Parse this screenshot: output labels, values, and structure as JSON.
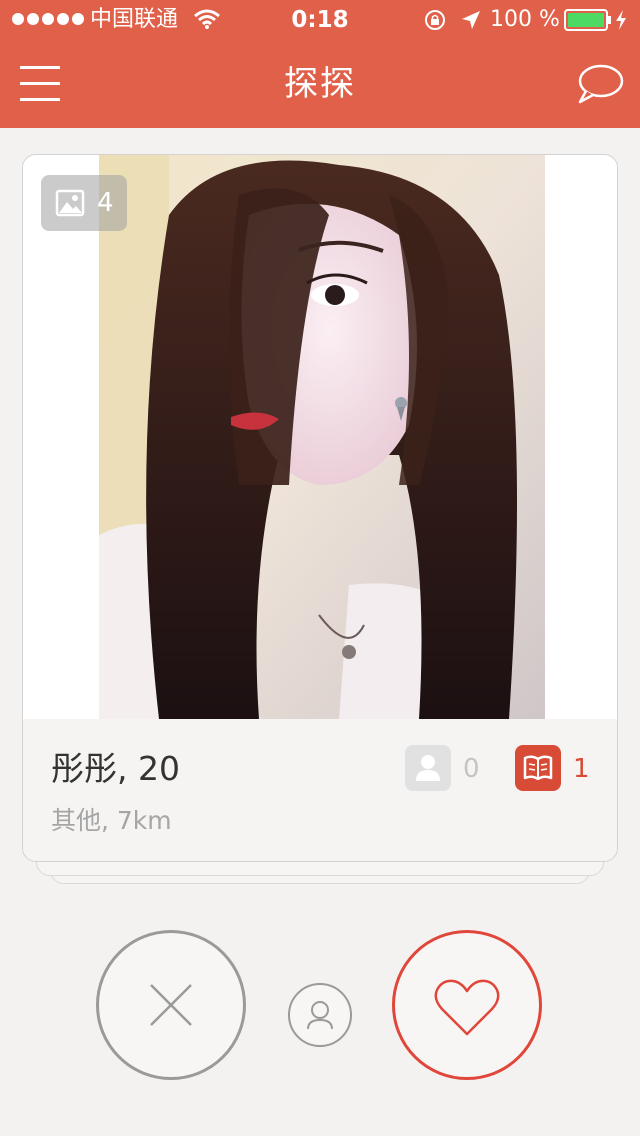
{
  "status_bar": {
    "carrier": "中国联通",
    "time": "0:18",
    "battery_percent": "100 %"
  },
  "nav": {
    "title": "探探",
    "left_icon": "hamburger-menu-icon",
    "right_icon": "chat-bubble-icon"
  },
  "card": {
    "photo_count": "4",
    "name_age": "彤彤, 20",
    "meta": "其他, 7km",
    "friends_count": "0",
    "moments_count": "1"
  },
  "actions": {
    "nope_icon": "close-x-icon",
    "profile_icon": "user-profile-icon",
    "like_icon": "heart-icon"
  },
  "colors": {
    "brand": "#e0604a",
    "like": "#e0473a",
    "moments_badge": "#d84b36",
    "background": "#f3f2f0"
  }
}
